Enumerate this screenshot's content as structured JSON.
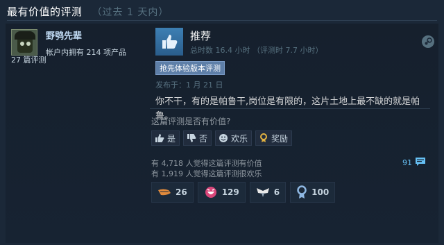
{
  "header": {
    "title": "最有价值的评测",
    "subtitle": "（过去 1 天内）"
  },
  "review": {
    "user": {
      "name": "野鸮先辈",
      "products": "帐户内拥有 214 项产品",
      "review_count": "27 篇评测"
    },
    "verdict": "推荐",
    "hours": "总时数 16.4 小时 （评测时 7.7 小时）",
    "badge": "抢先体验版本评测",
    "posted": "发布于：1 月 21 日",
    "text": "你不干，有的是帕鲁干,岗位是有限的，这片土地上最不缺的就是帕鲁。",
    "helpful_question": "这篇评测是否有价值?",
    "votes": {
      "yes": "是",
      "no": "否",
      "funny": "欢乐",
      "award": "奖励"
    },
    "stats": {
      "helpful": "有 4,718 人觉得这篇评测有价值",
      "funny": "有 1,919 人觉得这篇评测很欢乐"
    },
    "comment_count": "91",
    "awards": [
      {
        "icon": "deal-with-it-icon",
        "count": "26"
      },
      {
        "icon": "laughing-face-icon",
        "count": "129"
      },
      {
        "icon": "wings-icon",
        "count": "6"
      },
      {
        "icon": "medal-icon",
        "count": "100"
      }
    ],
    "colors": {
      "background": "#1b2838",
      "accent_blue": "#66c0f4",
      "thumb_box": "#3d7fb3",
      "badge": "#5e7fa8"
    }
  }
}
